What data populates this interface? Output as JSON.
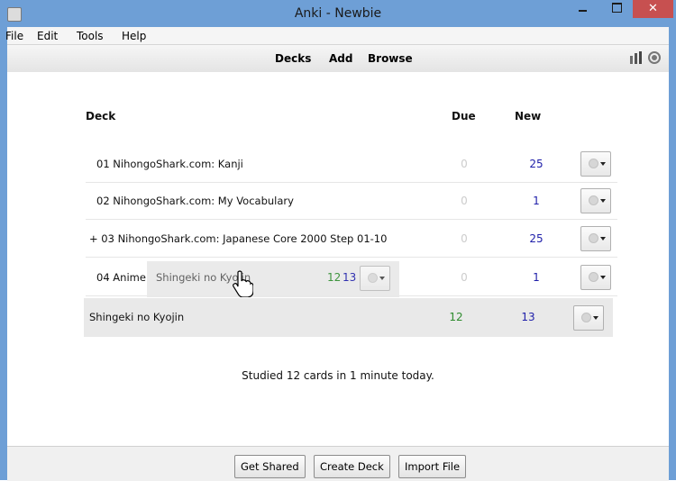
{
  "window": {
    "title": "Anki - Newbie",
    "close_glyph": "✕"
  },
  "menu": [
    "File",
    "Edit",
    "Tools",
    "Help"
  ],
  "toolbar": {
    "links": [
      "Decks",
      "Add",
      "Browse"
    ]
  },
  "table": {
    "headers": {
      "deck": "Deck",
      "due": "Due",
      "new": "New"
    },
    "rows": [
      {
        "name": "01 NihongoShark.com: Kanji",
        "due": "0",
        "new": "25"
      },
      {
        "name": "02 NihongoShark.com: My Vocabulary",
        "due": "0",
        "new": "1"
      },
      {
        "name": "+ 03 NihongoShark.com: Japanese Core 2000 Step 01-10",
        "due": "0",
        "new": "25"
      },
      {
        "name": "04 Anime",
        "due": "0",
        "new": "1"
      },
      {
        "name": "Shingeki no Kyojin",
        "due": "12",
        "new": "13"
      }
    ]
  },
  "drag_ghost": {
    "name": "Shingeki no Kyojin",
    "due": "12",
    "new": "13"
  },
  "status": "Studied 12 cards in 1 minute today.",
  "bottom_buttons": [
    "Get Shared",
    "Create Deck",
    "Import File"
  ],
  "colors": {
    "title_bar": "#6e9fd6",
    "close_button": "#c75050",
    "due_active": "#2e8b2e",
    "new_count": "#2020aa",
    "due_zero": "#cccccc"
  }
}
